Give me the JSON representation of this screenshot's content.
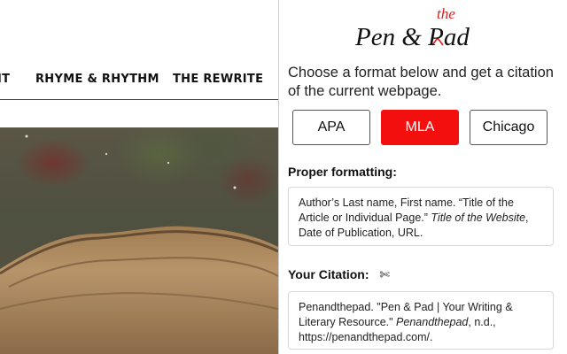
{
  "site": {
    "nav": [
      "IT",
      "RHYME & RHYTHM",
      "THE REWRITE"
    ]
  },
  "popup": {
    "logo": {
      "main": "Pen & Pad",
      "insert": "the"
    },
    "intro": "Choose a format below and get a citation of the current webpage.",
    "formats": [
      {
        "label": "APA",
        "selected": false
      },
      {
        "label": "MLA",
        "selected": true
      },
      {
        "label": "Chicago",
        "selected": false
      }
    ],
    "proper_formatting": {
      "title": "Proper formatting:",
      "part1": "Author’s Last name, First name. “Title of the Article or Individual Page.”",
      "italic": "Title of the Website",
      "part2": ", Date of Publication, URL."
    },
    "your_citation": {
      "title": "Your Citation:",
      "copy_icon": "scissors-icon",
      "part1": "Penandthepad. \"Pen & Pad | Your Writing & Literary Resource.\"",
      "italic": "Penandthepad",
      "part2": ", n.d., https://penandthepad.com/."
    }
  },
  "colors": {
    "accent": "#f40f0f",
    "logo_red": "#e41b1b"
  }
}
